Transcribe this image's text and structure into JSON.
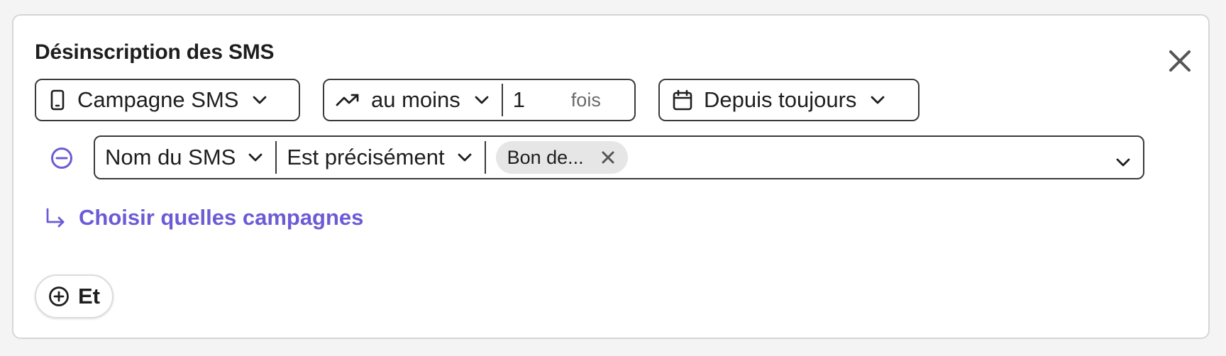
{
  "filter": {
    "title": "Désinscription des SMS",
    "channel": {
      "label": "Campagne SMS",
      "icon": "mobile-phone-icon"
    },
    "frequency": {
      "operator": "au moins",
      "count": "1",
      "unit": "fois",
      "icon": "trending-up-icon"
    },
    "period": {
      "label": "Depuis toujours",
      "icon": "calendar-icon"
    },
    "condition": {
      "field": "Nom du SMS",
      "operator": "Est précisément",
      "values": [
        "Bon de..."
      ]
    },
    "choose_link": "Choisir quelles campagnes",
    "add_and_label": "Et"
  },
  "colors": {
    "accent": "#6b5bd6",
    "border": "#3a3a3a",
    "chip_bg": "#e6e6e6",
    "card_border": "#d6d6d6",
    "page_bg": "#f4f4f4"
  }
}
